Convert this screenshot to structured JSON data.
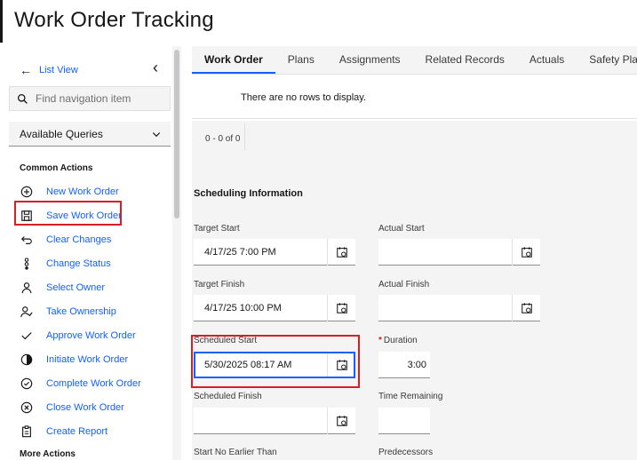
{
  "app": {
    "title": "Work Order Tracking"
  },
  "sidebar": {
    "list_view": "List View",
    "search_placeholder": "Find navigation item",
    "queries_label": "Available Queries",
    "common_actions_title": "Common Actions",
    "more_actions_title": "More Actions",
    "actions": [
      {
        "label": "New Work Order",
        "icon": "add-circle-icon"
      },
      {
        "label": "Save Work Order",
        "icon": "save-icon"
      },
      {
        "label": "Clear Changes",
        "icon": "undo-icon"
      },
      {
        "label": "Change Status",
        "icon": "status-icon"
      },
      {
        "label": "Select Owner",
        "icon": "user-icon"
      },
      {
        "label": "Take Ownership",
        "icon": "user-check-icon"
      },
      {
        "label": "Approve Work Order",
        "icon": "checkmark-icon"
      },
      {
        "label": "Initiate Work Order",
        "icon": "half-circle-icon"
      },
      {
        "label": "Complete Work Order",
        "icon": "checkmark-circle-icon"
      },
      {
        "label": "Close Work Order",
        "icon": "close-circle-icon"
      },
      {
        "label": "Create Report",
        "icon": "report-icon"
      }
    ]
  },
  "tabs": [
    "Work Order",
    "Plans",
    "Assignments",
    "Related Records",
    "Actuals",
    "Safety Plan"
  ],
  "table": {
    "empty_message": "There are no rows to display.",
    "pagination": "0 - 0 of 0"
  },
  "scheduling": {
    "title": "Scheduling Information",
    "target_start_label": "Target Start",
    "target_start_value": "4/17/25 7:00 PM",
    "actual_start_label": "Actual Start",
    "actual_start_value": "",
    "target_finish_label": "Target Finish",
    "target_finish_value": "4/17/25 10:00 PM",
    "actual_finish_label": "Actual Finish",
    "actual_finish_value": "",
    "scheduled_start_label": "Scheduled Start",
    "scheduled_start_value": "5/30/2025 08:17 AM",
    "duration_required": "*",
    "duration_label": "Duration",
    "duration_value": "3:00",
    "scheduled_finish_label": "Scheduled Finish",
    "scheduled_finish_value": "",
    "time_remaining_label": "Time Remaining",
    "time_remaining_value": "",
    "start_no_earlier_label": "Start No Earlier Than",
    "predecessors_label": "Predecessors"
  },
  "colors": {
    "accent": "#0f62fe",
    "highlight": "#da1e28"
  }
}
